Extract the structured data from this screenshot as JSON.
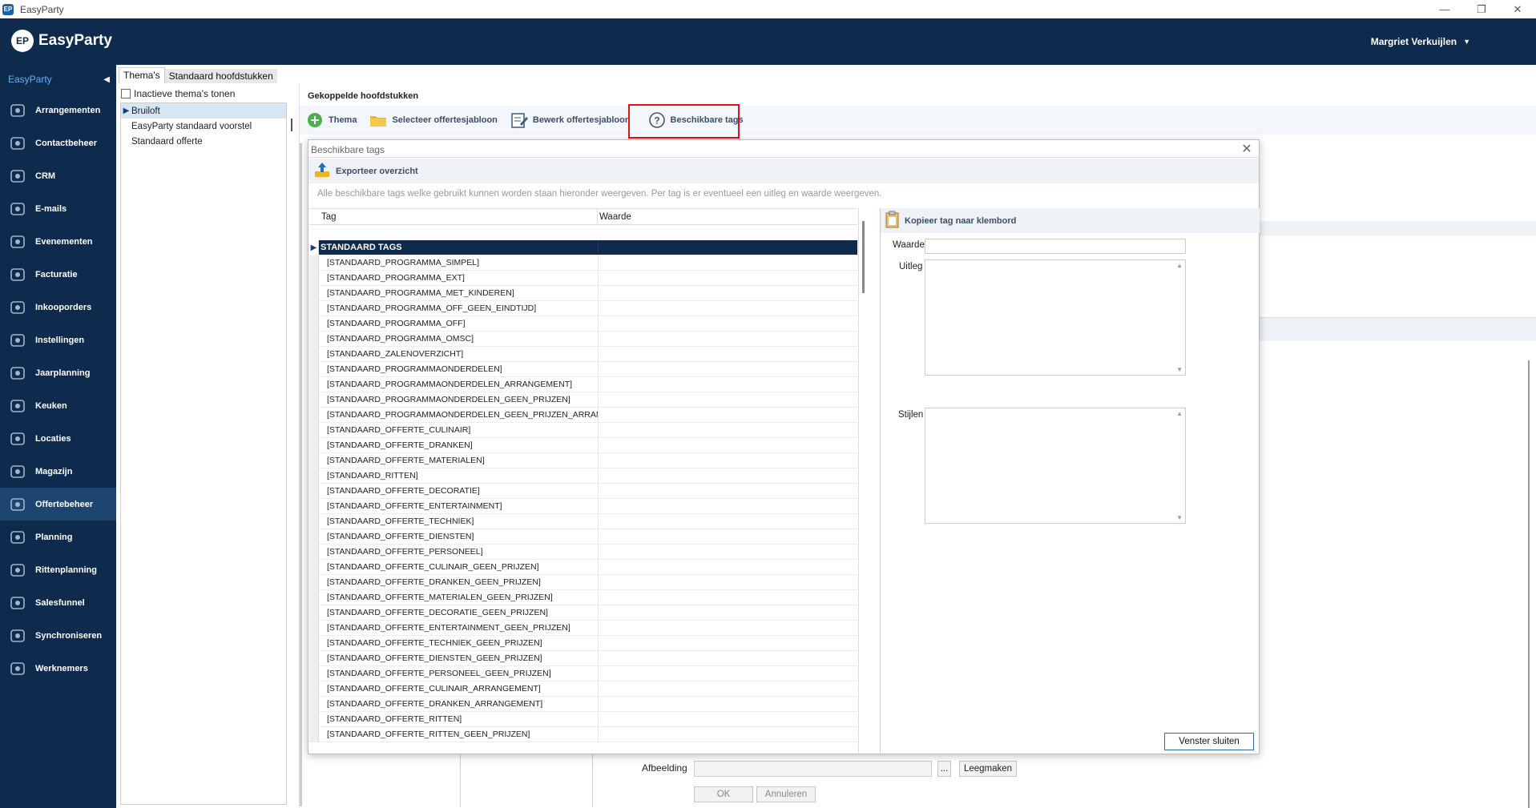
{
  "window": {
    "title": "EasyParty",
    "app_icon": "EP"
  },
  "header": {
    "logo_mark": "EP",
    "logo_text": "EasyParty",
    "user_name": "Margriet Verkuijlen"
  },
  "sidebar": {
    "title": "EasyParty",
    "items": [
      {
        "label": "Arrangementen",
        "icon": "people-icon"
      },
      {
        "label": "Contactbeheer",
        "icon": "contacts-icon"
      },
      {
        "label": "CRM",
        "icon": "crm-icon"
      },
      {
        "label": "E-mails",
        "icon": "mail-icon"
      },
      {
        "label": "Evenementen",
        "icon": "cocktail-icon"
      },
      {
        "label": "Facturatie",
        "icon": "invoice-icon"
      },
      {
        "label": "Inkooporders",
        "icon": "cart-icon"
      },
      {
        "label": "Instellingen",
        "icon": "gear-icon"
      },
      {
        "label": "Jaarplanning",
        "icon": "calendar-icon"
      },
      {
        "label": "Keuken",
        "icon": "knife-icon"
      },
      {
        "label": "Locaties",
        "icon": "building-icon"
      },
      {
        "label": "Magazijn",
        "icon": "box-icon"
      },
      {
        "label": "Offertebeheer",
        "icon": "offer-icon",
        "active": true
      },
      {
        "label": "Planning",
        "icon": "planning-icon"
      },
      {
        "label": "Rittenplanning",
        "icon": "truck-icon"
      },
      {
        "label": "Salesfunnel",
        "icon": "funnel-icon"
      },
      {
        "label": "Synchroniseren",
        "icon": "sync-icon"
      },
      {
        "label": "Werknemers",
        "icon": "person-icon"
      }
    ]
  },
  "tabs": [
    {
      "label": "Thema's"
    },
    {
      "label": "Standaard hoofdstukken"
    }
  ],
  "theme_panel": {
    "inactive_checkbox_label": "Inactieve thema's tonen",
    "themes": [
      "Bruiloft",
      "EasyParty standaard voorstel",
      "Standaard offerte"
    ]
  },
  "main": {
    "linked_header": "Gekoppelde hoofdstukken",
    "toolbar": {
      "theme": "Thema",
      "select_template": "Selecteer offertesjabloon",
      "edit_template": "Bewerk offertesjabloon",
      "available_tags": "Beschikbare tags"
    },
    "bg_form": {
      "image_label": "Afbeelding",
      "browse_label": "...",
      "clear_label": "Leegmaken",
      "ok_label": "OK",
      "cancel_label": "Annuleren"
    }
  },
  "dialog": {
    "title": "Beschikbare tags",
    "export_label": "Exporteer overzicht",
    "info_text": "Alle beschikbare tags welke gebruikt kunnen worden staan hieronder weergeven. Per tag is er eventueel een uitleg en waarde weergeven.",
    "columns": {
      "tag": "Tag",
      "value": "Waarde"
    },
    "group_label": "STANDAARD TAGS",
    "tags": [
      "[STANDAARD_PROGRAMMA_SIMPEL]",
      "[STANDAARD_PROGRAMMA_EXT]",
      "[STANDAARD_PROGRAMMA_MET_KINDEREN]",
      "[STANDAARD_PROGRAMMA_OFF_GEEN_EINDTIJD]",
      "[STANDAARD_PROGRAMMA_OFF]",
      "[STANDAARD_PROGRAMMA_OMSC]",
      "[STANDAARD_ZALENOVERZICHT]",
      "[STANDAARD_PROGRAMMAONDERDELEN]",
      "[STANDAARD_PROGRAMMAONDERDELEN_ARRANGEMENT]",
      "[STANDAARD_PROGRAMMAONDERDELEN_GEEN_PRIJZEN]",
      "[STANDAARD_PROGRAMMAONDERDELEN_GEEN_PRIJZEN_ARRANGEMENT]",
      "[STANDAARD_OFFERTE_CULINAIR]",
      "[STANDAARD_OFFERTE_DRANKEN]",
      "[STANDAARD_OFFERTE_MATERIALEN]",
      "[STANDAARD_RITTEN]",
      "[STANDAARD_OFFERTE_DECORATIE]",
      "[STANDAARD_OFFERTE_ENTERTAINMENT]",
      "[STANDAARD_OFFERTE_TECHNIEK]",
      "[STANDAARD_OFFERTE_DIENSTEN]",
      "[STANDAARD_OFFERTE_PERSONEEL]",
      "[STANDAARD_OFFERTE_CULINAIR_GEEN_PRIJZEN]",
      "[STANDAARD_OFFERTE_DRANKEN_GEEN_PRIJZEN]",
      "[STANDAARD_OFFERTE_MATERIALEN_GEEN_PRIJZEN]",
      "[STANDAARD_OFFERTE_DECORATIE_GEEN_PRIJZEN]",
      "[STANDAARD_OFFERTE_ENTERTAINMENT_GEEN_PRIJZEN]",
      "[STANDAARD_OFFERTE_TECHNIEK_GEEN_PRIJZEN]",
      "[STANDAARD_OFFERTE_DIENSTEN_GEEN_PRIJZEN]",
      "[STANDAARD_OFFERTE_PERSONEEL_GEEN_PRIJZEN]",
      "[STANDAARD_OFFERTE_CULINAIR_ARRANGEMENT]",
      "[STANDAARD_OFFERTE_DRANKEN_ARRANGEMENT]",
      "[STANDAARD_OFFERTE_RITTEN]",
      "[STANDAARD_OFFERTE_RITTEN_GEEN_PRIJZEN]"
    ],
    "detail": {
      "copy_label": "Kopieer tag naar klembord",
      "value_label": "Waarde",
      "explanation_label": "Uitleg",
      "styles_label": "Stijlen",
      "value": ""
    },
    "close_label": "Venster sluiten"
  },
  "colors": {
    "header_bg": "#0e2a4c",
    "accent": "#5bb4ff",
    "highlight": "#e01414"
  }
}
